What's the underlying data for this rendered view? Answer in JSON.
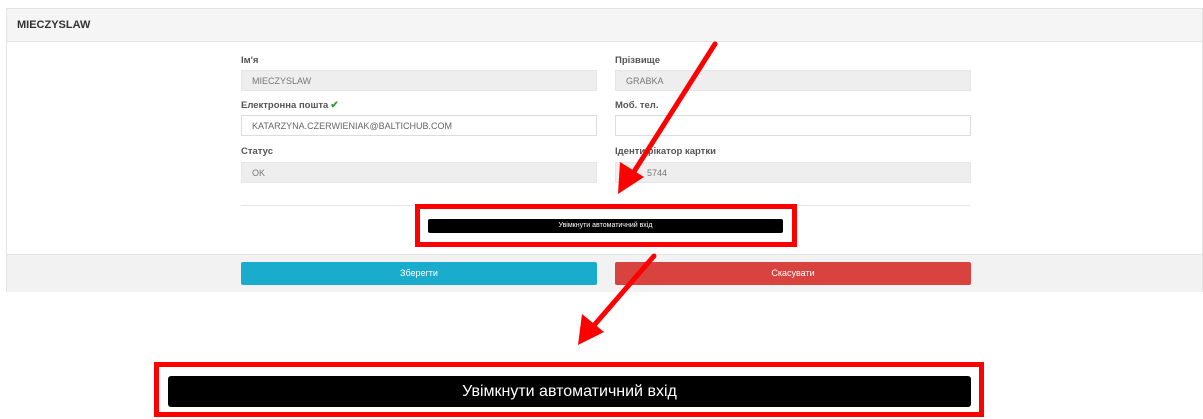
{
  "panel": {
    "title": "MIECZYSLAW"
  },
  "form": {
    "first_name": {
      "label": "Ім'я",
      "value": "MIECZYSLAW"
    },
    "last_name": {
      "label": "Прізвище",
      "value": "GRABKA"
    },
    "email": {
      "label": "Електронна пошта",
      "value": "KATARZYNA.CZERWIENIAK@BALTICHUB.COM",
      "verified_icon": "check-icon"
    },
    "mobile": {
      "label": "Моб. тел.",
      "value": ""
    },
    "status": {
      "label": "Статус",
      "value": "OK"
    },
    "card_id": {
      "label": "Ідентифікатор картки",
      "value": "5744"
    }
  },
  "actions": {
    "auto_login_label": "Увімкнути автоматичний вхід",
    "save_label": "Зберегти",
    "cancel_label": "Скасувати"
  },
  "zoomed": {
    "auto_login_label": "Увімкнути автоматичний вхід"
  },
  "colors": {
    "save": "#1aaccc",
    "cancel": "#d9433f",
    "annotation": "#ff0000",
    "auto_login_bg": "#000000"
  }
}
